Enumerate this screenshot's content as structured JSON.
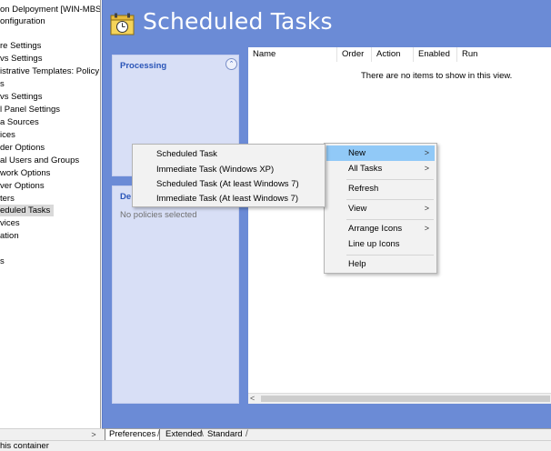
{
  "tree": {
    "items": [
      "on Delpoyment [WIN-MBS-",
      "onfiguration",
      "",
      "re Settings",
      "vs Settings",
      "istrative Templates: Policy d",
      "s",
      "vs Settings",
      "l Panel Settings",
      "a Sources",
      "ices",
      "der Options",
      "al Users and Groups",
      "work Options",
      "ver Options",
      "ters",
      "eduled Tasks",
      "vices",
      "ation",
      "",
      "s"
    ],
    "scroll_right": ">"
  },
  "header": {
    "title": "Scheduled Tasks",
    "icon": "scheduled-tasks-icon"
  },
  "processing_panel": {
    "title": "Processing",
    "collapse_icon": "double-chevron-up-icon",
    "collapse_glyph": "⌃"
  },
  "description_panel": {
    "title": "De",
    "text": "No policies selected"
  },
  "list": {
    "columns": [
      "Name",
      "Order",
      "Action",
      "Enabled",
      "Run"
    ],
    "empty_message": "There are no items to show in this view.",
    "scroll_left": "<"
  },
  "tabs": [
    "Preferences",
    "Extended",
    "Standard"
  ],
  "status": {
    "text": "his container"
  },
  "context_menu": {
    "items": [
      {
        "label": "New",
        "has_submenu": true
      },
      {
        "label": "All Tasks",
        "has_submenu": true
      },
      {
        "label": "Refresh",
        "has_submenu": false
      },
      {
        "label": "View",
        "has_submenu": true
      },
      {
        "label": "Arrange Icons",
        "has_submenu": true
      },
      {
        "label": "Line up Icons",
        "has_submenu": false
      },
      {
        "label": "Help",
        "has_submenu": false
      }
    ],
    "submenu_arrow": ">"
  },
  "submenu": {
    "items": [
      "Scheduled Task",
      "Immediate Task (Windows XP)",
      "Scheduled Task (At least Windows 7)",
      "Immediate Task (At least Windows 7)"
    ]
  },
  "colors": {
    "main_background": "#6b8bd6",
    "panel_background": "#d8dff6",
    "panel_title": "#2a55b8",
    "menu_highlight": "#91c9f7"
  }
}
